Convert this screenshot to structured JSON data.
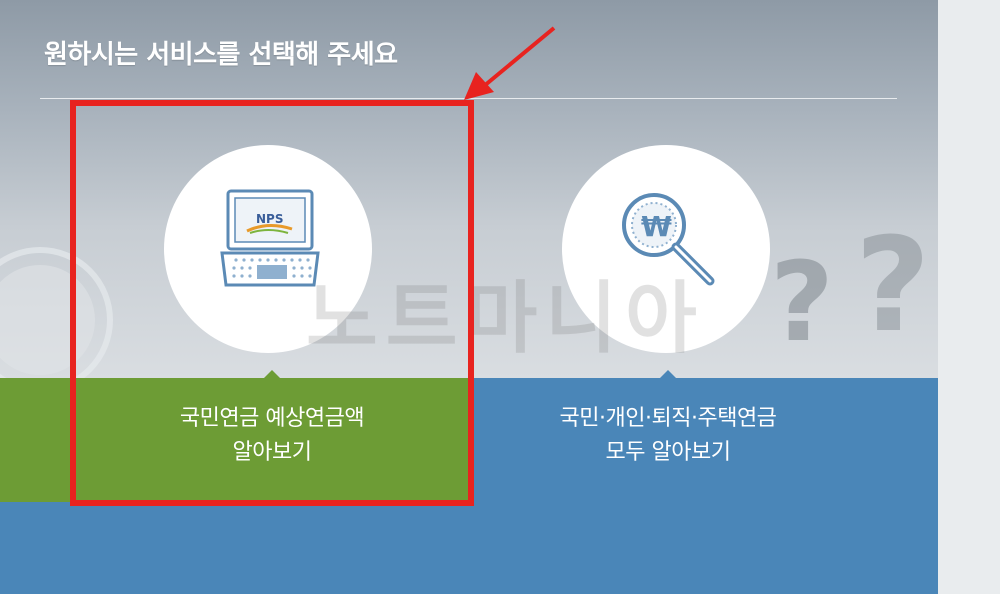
{
  "header": {
    "title": "원하시는 서비스를 선택해 주세요"
  },
  "cards": [
    {
      "label_line1": "국민연금 예상연금액",
      "label_line2": "알아보기",
      "icon": "laptop-nps-icon",
      "icon_text": "NPS",
      "color": "#6d9c35"
    },
    {
      "label_line1": "국민·개인·퇴직·주택연금",
      "label_line2": "모두 알아보기",
      "icon": "won-magnifier-icon",
      "color": "#4a86b8"
    }
  ],
  "watermark": "노트마니아",
  "annotation": {
    "box_color": "#e8231f"
  }
}
